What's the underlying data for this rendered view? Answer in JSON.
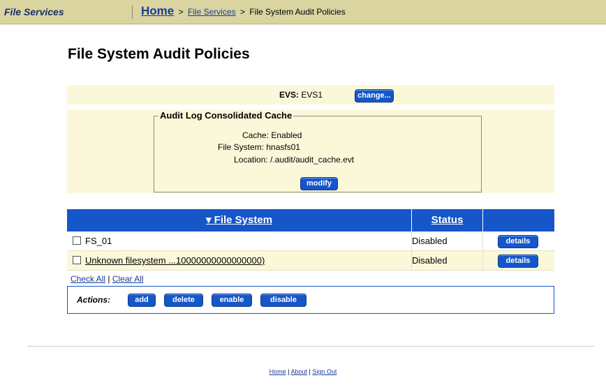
{
  "header": {
    "app_title": "File Services",
    "breadcrumb": {
      "home": "Home",
      "sep1": ">",
      "file_services": "File Services",
      "sep2": ">",
      "current": "File System Audit Policies"
    }
  },
  "page_title": "File System Audit Policies",
  "evs": {
    "label": "EVS:",
    "value": "EVS1",
    "change_button": "change..."
  },
  "cache": {
    "legend": "Audit Log Consolidated Cache",
    "cache_label": "Cache:",
    "cache_value": "Enabled",
    "fs_label": "File System:",
    "fs_value": "hnasfs01",
    "location_label": "Location:",
    "location_value": "/.audit/audit_cache.evt",
    "modify_button": "modify"
  },
  "table": {
    "sort_indicator": "▾",
    "col_file_system": "File System",
    "col_status": "Status",
    "rows": [
      {
        "name": "FS_01",
        "status": "Disabled",
        "details": "details"
      },
      {
        "name": "Unknown filesystem ...10000000000000000)",
        "status": "Disabled",
        "details": "details"
      }
    ],
    "check_all": "Check All",
    "pipe": "|",
    "clear_all": "Clear All"
  },
  "actions": {
    "label": "Actions:",
    "add": "add",
    "delete": "delete",
    "enable": "enable",
    "disable": "disable"
  },
  "footer": {
    "home": "Home",
    "about": "About",
    "sign_out": "Sign Out",
    "pipe": "|"
  },
  "colors": {
    "header_bar": "#d9d4a0",
    "panel_bg": "#fbf8d9",
    "accent_blue": "#1556c9"
  }
}
